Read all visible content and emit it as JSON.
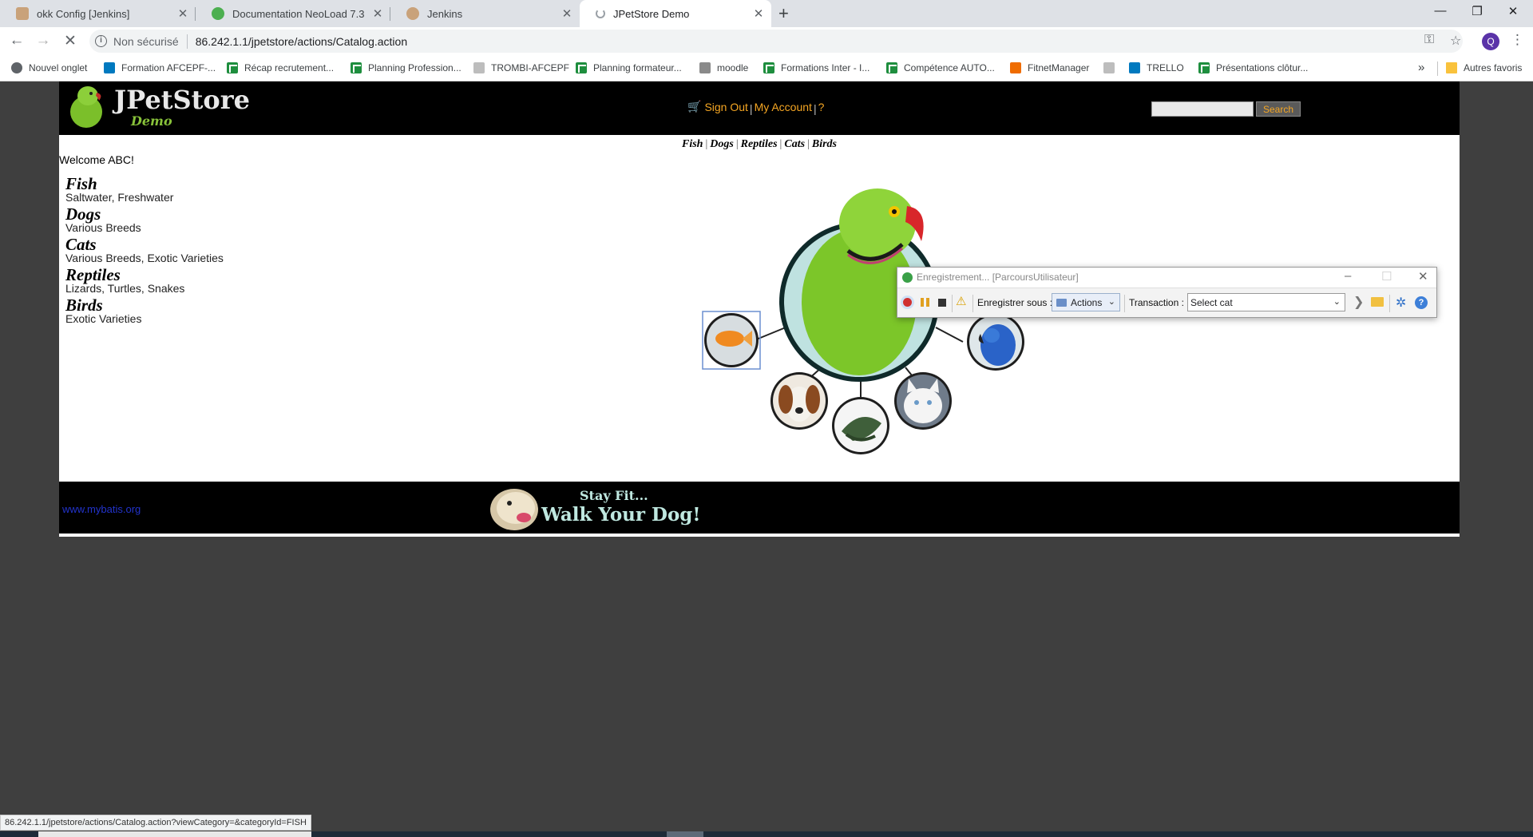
{
  "tabs": [
    {
      "title": "okk Config [Jenkins]",
      "icon": "jenkins-icon"
    },
    {
      "title": "Documentation NeoLoad 7.3",
      "icon": "neoload-icon"
    },
    {
      "title": "Jenkins",
      "icon": "jenkins-icon"
    },
    {
      "title": "JPetStore Demo",
      "icon": "loading-icon"
    }
  ],
  "address": {
    "security": "Non sécurisé",
    "url": "86.242.1.1/jpetstore/actions/Catalog.action"
  },
  "profile_initial": "Q",
  "bookmarks": [
    {
      "label": "Nouvel onglet",
      "icon": "globe"
    },
    {
      "label": "Formation AFCEPF-...",
      "icon": "trello"
    },
    {
      "label": "Récap recrutement...",
      "icon": "sheets"
    },
    {
      "label": "Planning Profession...",
      "icon": "sheets"
    },
    {
      "label": "TROMBI-AFCEPF",
      "icon": "generic"
    },
    {
      "label": "Planning formateur...",
      "icon": "sheets"
    },
    {
      "label": "moodle",
      "icon": "moodle"
    },
    {
      "label": "Formations Inter - I...",
      "icon": "sheets"
    },
    {
      "label": "Compétence AUTO...",
      "icon": "sheets"
    },
    {
      "label": "FitnetManager",
      "icon": "fitnet"
    },
    {
      "label": "TRELLO",
      "icon": "trello"
    },
    {
      "label": "Présentations clôtur...",
      "icon": "sheets"
    }
  ],
  "other_bookmarks": "Autres favoris",
  "store": {
    "logo_title": "JPetStore",
    "logo_sub": "Demo",
    "menu": {
      "sign_out": "Sign Out",
      "my_account": "My Account",
      "help": "?"
    },
    "search_button": "Search",
    "quick_links": [
      "Fish",
      "Dogs",
      "Reptiles",
      "Cats",
      "Birds"
    ],
    "welcome": "Welcome ABC!",
    "categories": [
      {
        "name": "Fish",
        "desc": "Saltwater, Freshwater"
      },
      {
        "name": "Dogs",
        "desc": "Various Breeds"
      },
      {
        "name": "Cats",
        "desc": "Various Breeds, Exotic Varieties"
      },
      {
        "name": "Reptiles",
        "desc": "Lizards, Turtles, Snakes"
      },
      {
        "name": "Birds",
        "desc": "Exotic Varieties"
      }
    ],
    "footer_link": "www.mybatis.org",
    "banner_line1": "Stay Fit...",
    "banner_line2": "Walk Your Dog!"
  },
  "recorder": {
    "title": "Enregistrement... [ParcoursUtilisateur]",
    "save_label": "Enregistrer sous :",
    "actions_value": "Actions",
    "transaction_label": "Transaction :",
    "transaction_value": "Select cat"
  },
  "status_url": "86.242.1.1/jpetstore/actions/Catalog.action?viewCategory=&categoryId=FISH",
  "colors": {
    "accent": "#f5a623",
    "header_bg": "#000000",
    "page_bg": "#3f3f3f"
  }
}
